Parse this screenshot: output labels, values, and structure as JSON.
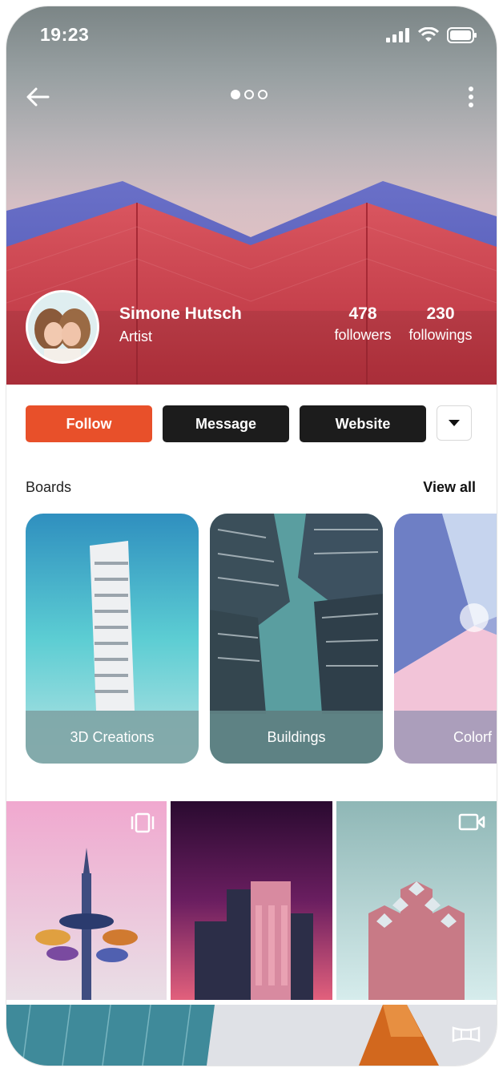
{
  "status": {
    "time": "19:23"
  },
  "profile": {
    "name": "Simone Hutsch",
    "role": "Artist",
    "followers_count": "478",
    "followers_label": "followers",
    "followings_count": "230",
    "followings_label": "followings"
  },
  "actions": {
    "follow": "Follow",
    "message": "Message",
    "website": "Website"
  },
  "boards": {
    "title": "Boards",
    "view_all": "View all",
    "items": [
      {
        "label": "3D Creations"
      },
      {
        "label": "Buildings"
      },
      {
        "label": "Colorf"
      }
    ]
  },
  "icons": {
    "back": "arrow-left-icon",
    "more": "more-vertical-icon",
    "carousel": "carousel-icon",
    "video": "video-icon",
    "panorama": "panorama-icon"
  },
  "colors": {
    "accent": "#e8502a",
    "dark": "#1c1c1c"
  }
}
